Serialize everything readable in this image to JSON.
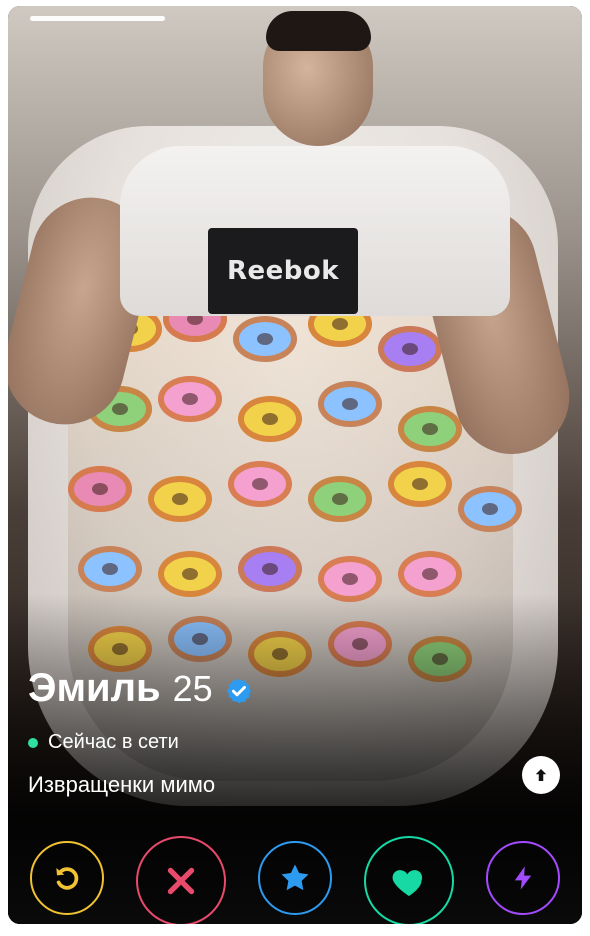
{
  "profile": {
    "name": "Эмиль",
    "age": "25",
    "status_text": "Сейчас в сети",
    "bio": "Извращенки мимо",
    "shirt_text": "Reebok"
  },
  "icons": {
    "verified": "verified-badge-icon",
    "info": "arrow-up-icon",
    "rewind": "rewind-icon",
    "nope": "close-icon",
    "super_like": "star-icon",
    "like": "heart-icon",
    "boost": "lightning-icon"
  },
  "colors": {
    "online": "#2fe0a0",
    "rewind": "#f1c232",
    "nope": "#e84a6c",
    "super_like": "#2d9bf0",
    "like": "#16d9a4",
    "boost": "#a34bff",
    "verified": "#2d9bf0"
  },
  "photo_progress": {
    "current_photo": 1
  }
}
